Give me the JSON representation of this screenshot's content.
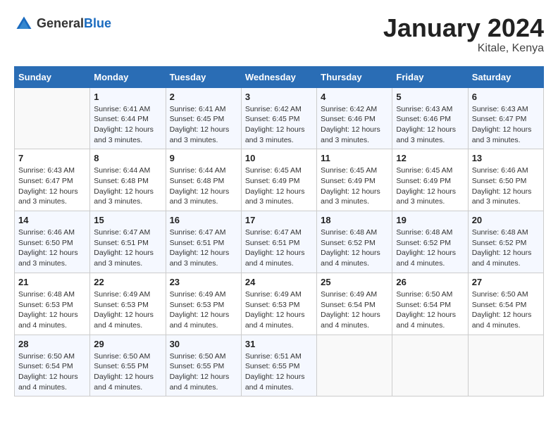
{
  "header": {
    "logo_general": "General",
    "logo_blue": "Blue",
    "month_title": "January 2024",
    "location": "Kitale, Kenya"
  },
  "calendar": {
    "days_of_week": [
      "Sunday",
      "Monday",
      "Tuesday",
      "Wednesday",
      "Thursday",
      "Friday",
      "Saturday"
    ],
    "weeks": [
      [
        {
          "day": "",
          "sunrise": "",
          "sunset": "",
          "daylight": ""
        },
        {
          "day": "1",
          "sunrise": "Sunrise: 6:41 AM",
          "sunset": "Sunset: 6:44 PM",
          "daylight": "Daylight: 12 hours and 3 minutes."
        },
        {
          "day": "2",
          "sunrise": "Sunrise: 6:41 AM",
          "sunset": "Sunset: 6:45 PM",
          "daylight": "Daylight: 12 hours and 3 minutes."
        },
        {
          "day": "3",
          "sunrise": "Sunrise: 6:42 AM",
          "sunset": "Sunset: 6:45 PM",
          "daylight": "Daylight: 12 hours and 3 minutes."
        },
        {
          "day": "4",
          "sunrise": "Sunrise: 6:42 AM",
          "sunset": "Sunset: 6:46 PM",
          "daylight": "Daylight: 12 hours and 3 minutes."
        },
        {
          "day": "5",
          "sunrise": "Sunrise: 6:43 AM",
          "sunset": "Sunset: 6:46 PM",
          "daylight": "Daylight: 12 hours and 3 minutes."
        },
        {
          "day": "6",
          "sunrise": "Sunrise: 6:43 AM",
          "sunset": "Sunset: 6:47 PM",
          "daylight": "Daylight: 12 hours and 3 minutes."
        }
      ],
      [
        {
          "day": "7",
          "sunrise": "Sunrise: 6:43 AM",
          "sunset": "Sunset: 6:47 PM",
          "daylight": "Daylight: 12 hours and 3 minutes."
        },
        {
          "day": "8",
          "sunrise": "Sunrise: 6:44 AM",
          "sunset": "Sunset: 6:48 PM",
          "daylight": "Daylight: 12 hours and 3 minutes."
        },
        {
          "day": "9",
          "sunrise": "Sunrise: 6:44 AM",
          "sunset": "Sunset: 6:48 PM",
          "daylight": "Daylight: 12 hours and 3 minutes."
        },
        {
          "day": "10",
          "sunrise": "Sunrise: 6:45 AM",
          "sunset": "Sunset: 6:49 PM",
          "daylight": "Daylight: 12 hours and 3 minutes."
        },
        {
          "day": "11",
          "sunrise": "Sunrise: 6:45 AM",
          "sunset": "Sunset: 6:49 PM",
          "daylight": "Daylight: 12 hours and 3 minutes."
        },
        {
          "day": "12",
          "sunrise": "Sunrise: 6:45 AM",
          "sunset": "Sunset: 6:49 PM",
          "daylight": "Daylight: 12 hours and 3 minutes."
        },
        {
          "day": "13",
          "sunrise": "Sunrise: 6:46 AM",
          "sunset": "Sunset: 6:50 PM",
          "daylight": "Daylight: 12 hours and 3 minutes."
        }
      ],
      [
        {
          "day": "14",
          "sunrise": "Sunrise: 6:46 AM",
          "sunset": "Sunset: 6:50 PM",
          "daylight": "Daylight: 12 hours and 3 minutes."
        },
        {
          "day": "15",
          "sunrise": "Sunrise: 6:47 AM",
          "sunset": "Sunset: 6:51 PM",
          "daylight": "Daylight: 12 hours and 3 minutes."
        },
        {
          "day": "16",
          "sunrise": "Sunrise: 6:47 AM",
          "sunset": "Sunset: 6:51 PM",
          "daylight": "Daylight: 12 hours and 3 minutes."
        },
        {
          "day": "17",
          "sunrise": "Sunrise: 6:47 AM",
          "sunset": "Sunset: 6:51 PM",
          "daylight": "Daylight: 12 hours and 4 minutes."
        },
        {
          "day": "18",
          "sunrise": "Sunrise: 6:48 AM",
          "sunset": "Sunset: 6:52 PM",
          "daylight": "Daylight: 12 hours and 4 minutes."
        },
        {
          "day": "19",
          "sunrise": "Sunrise: 6:48 AM",
          "sunset": "Sunset: 6:52 PM",
          "daylight": "Daylight: 12 hours and 4 minutes."
        },
        {
          "day": "20",
          "sunrise": "Sunrise: 6:48 AM",
          "sunset": "Sunset: 6:52 PM",
          "daylight": "Daylight: 12 hours and 4 minutes."
        }
      ],
      [
        {
          "day": "21",
          "sunrise": "Sunrise: 6:48 AM",
          "sunset": "Sunset: 6:53 PM",
          "daylight": "Daylight: 12 hours and 4 minutes."
        },
        {
          "day": "22",
          "sunrise": "Sunrise: 6:49 AM",
          "sunset": "Sunset: 6:53 PM",
          "daylight": "Daylight: 12 hours and 4 minutes."
        },
        {
          "day": "23",
          "sunrise": "Sunrise: 6:49 AM",
          "sunset": "Sunset: 6:53 PM",
          "daylight": "Daylight: 12 hours and 4 minutes."
        },
        {
          "day": "24",
          "sunrise": "Sunrise: 6:49 AM",
          "sunset": "Sunset: 6:53 PM",
          "daylight": "Daylight: 12 hours and 4 minutes."
        },
        {
          "day": "25",
          "sunrise": "Sunrise: 6:49 AM",
          "sunset": "Sunset: 6:54 PM",
          "daylight": "Daylight: 12 hours and 4 minutes."
        },
        {
          "day": "26",
          "sunrise": "Sunrise: 6:50 AM",
          "sunset": "Sunset: 6:54 PM",
          "daylight": "Daylight: 12 hours and 4 minutes."
        },
        {
          "day": "27",
          "sunrise": "Sunrise: 6:50 AM",
          "sunset": "Sunset: 6:54 PM",
          "daylight": "Daylight: 12 hours and 4 minutes."
        }
      ],
      [
        {
          "day": "28",
          "sunrise": "Sunrise: 6:50 AM",
          "sunset": "Sunset: 6:54 PM",
          "daylight": "Daylight: 12 hours and 4 minutes."
        },
        {
          "day": "29",
          "sunrise": "Sunrise: 6:50 AM",
          "sunset": "Sunset: 6:55 PM",
          "daylight": "Daylight: 12 hours and 4 minutes."
        },
        {
          "day": "30",
          "sunrise": "Sunrise: 6:50 AM",
          "sunset": "Sunset: 6:55 PM",
          "daylight": "Daylight: 12 hours and 4 minutes."
        },
        {
          "day": "31",
          "sunrise": "Sunrise: 6:51 AM",
          "sunset": "Sunset: 6:55 PM",
          "daylight": "Daylight: 12 hours and 4 minutes."
        },
        {
          "day": "",
          "sunrise": "",
          "sunset": "",
          "daylight": ""
        },
        {
          "day": "",
          "sunrise": "",
          "sunset": "",
          "daylight": ""
        },
        {
          "day": "",
          "sunrise": "",
          "sunset": "",
          "daylight": ""
        }
      ]
    ]
  }
}
